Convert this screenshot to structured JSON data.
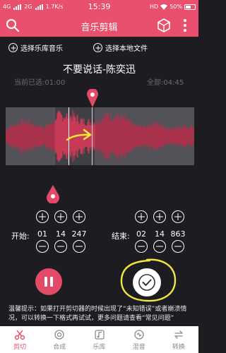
{
  "status_bar": {
    "left_net1": "4G",
    "left_net2": "2G",
    "speed": "1.7K/s",
    "time": "15:39",
    "hd": "HD",
    "battery": "50%"
  },
  "app_bar": {
    "title": "音乐剪辑"
  },
  "pickers": {
    "library": "选择乐库音乐",
    "local": "选择本地文件"
  },
  "song": {
    "title": "不要说话-陈奕迅",
    "current": "当前已选:01:00",
    "total": "全部:04:45"
  },
  "start": {
    "label": "开始:",
    "min": "01",
    "sec": "14",
    "ms": "247"
  },
  "end": {
    "label": "结束:",
    "min": "02",
    "sec": "14",
    "ms": "863"
  },
  "tip": "温馨提示：如果打开剪切器的时候出现了“未知错误”或者崩溃情况，可以转换一下格式再试试，更多问题请查看“常见问题”",
  "tabs": [
    {
      "label": "剪切",
      "icon": "scissors-icon"
    },
    {
      "label": "合成",
      "icon": "merge-icon"
    },
    {
      "label": "乐库",
      "icon": "music-note-icon"
    },
    {
      "label": "混音",
      "icon": "mix-icon"
    },
    {
      "label": "转换",
      "icon": "convert-icon"
    }
  ],
  "colors": {
    "accent": "#e8506d",
    "background": "#1d1c20",
    "wave_bg": "#535259",
    "annotation": "#f2e83a"
  }
}
